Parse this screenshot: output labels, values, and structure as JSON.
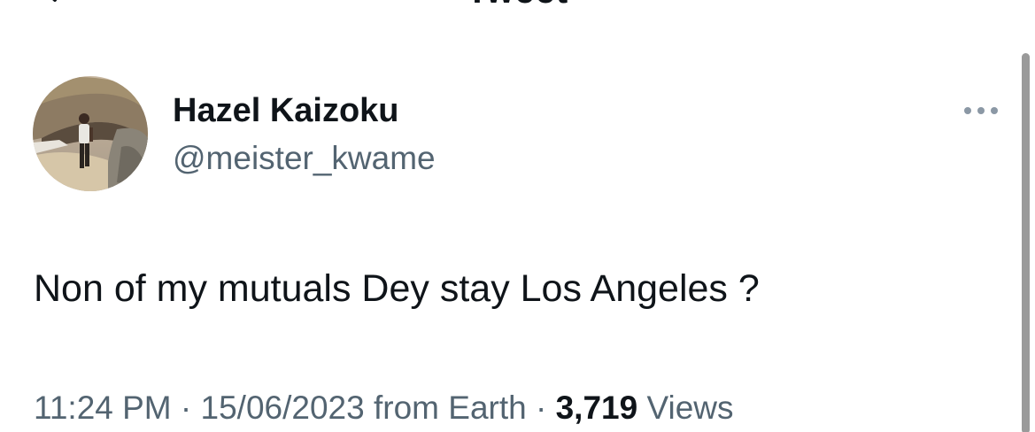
{
  "header": {
    "title": "Tweet",
    "back_icon": "back-arrow-icon"
  },
  "author": {
    "name": "Hazel Kaizoku",
    "handle": "@meister_kwame",
    "more_icon": "more-horizontal-icon"
  },
  "tweet": {
    "text": "Non of my mutuals Dey stay Los Angeles ?"
  },
  "meta": {
    "time": "11:24 PM",
    "separator": "·",
    "date": "15/06/2023",
    "source": "from Earth",
    "views_count": "3,719",
    "views_label": "Views"
  },
  "colors": {
    "text_primary": "#0f1419",
    "text_secondary": "#536471",
    "scrollbar": "#9a9a9a"
  }
}
